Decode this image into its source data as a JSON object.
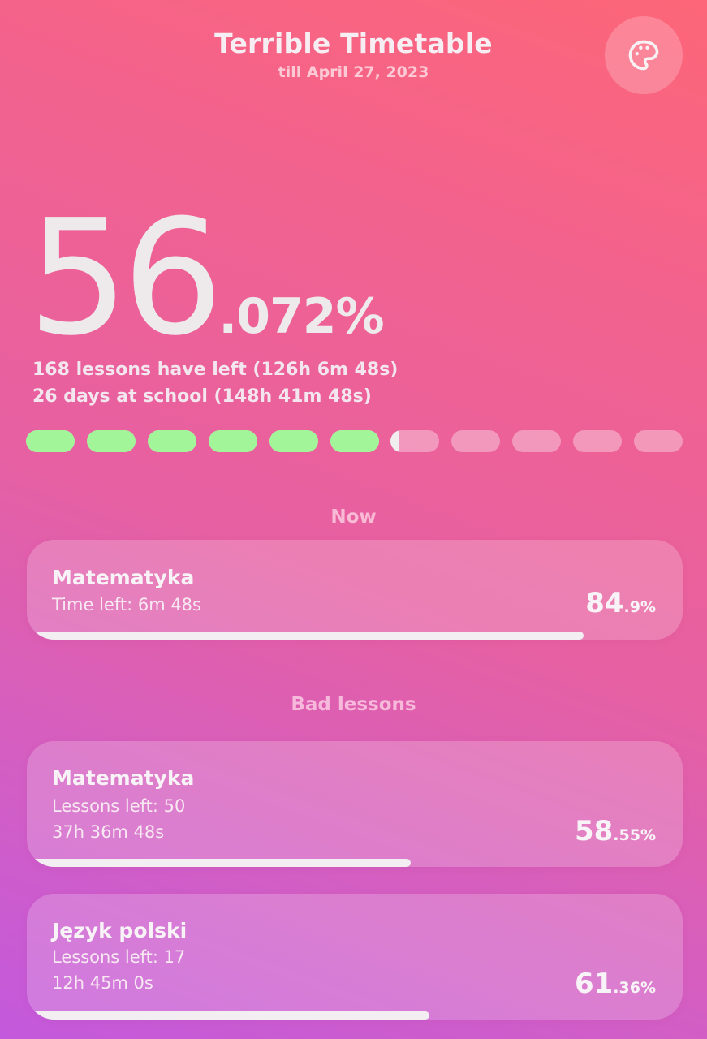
{
  "app": {
    "title": "Terrible Timetable",
    "subtitle": "till April 27, 2023",
    "theme_icon": "palette-icon"
  },
  "summary": {
    "percent_int": "56",
    "percent_frac": ".072%",
    "progress": 0.56072,
    "lessons_left_text": "168 lessons have left (126h 6m 48s)",
    "days_left_text": "26 days at school (148h 41m 48s)"
  },
  "segments": {
    "count": 11,
    "done_color": "#a3f59a",
    "current_color": "#f1eeef",
    "pending_color": "rgba(255,255,255,0.35)"
  },
  "now": {
    "label": "Now",
    "card": {
      "title": "Matematyka",
      "line1": "Time left: 6m 48s",
      "pct_int": "84",
      "pct_frac": ".9%",
      "progress": 0.849
    }
  },
  "bad_lessons": {
    "label": "Bad lessons",
    "items": [
      {
        "title": "Matematyka",
        "line1": "Lessons left: 50",
        "line2": "37h 36m 48s",
        "pct_int": "58",
        "pct_frac": ".55%",
        "progress": 0.5855
      },
      {
        "title": "Język polski",
        "line1": "Lessons left: 17",
        "line2": "12h 45m 0s",
        "pct_int": "61",
        "pct_frac": ".36%",
        "progress": 0.6136
      }
    ]
  }
}
